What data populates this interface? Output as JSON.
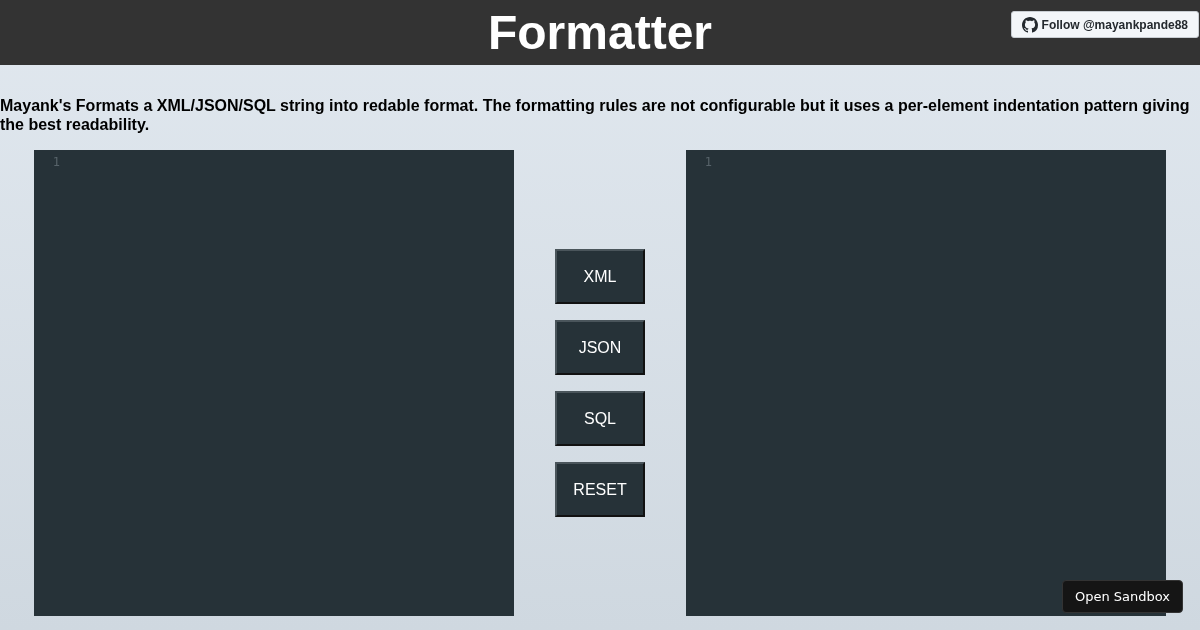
{
  "header": {
    "title": "Formatter",
    "follow_button": {
      "label": "Follow @mayankpande88"
    }
  },
  "description": "Mayank's Formats a XML/JSON/SQL string into redable format. The formatting rules are not configurable but it uses a per-element indentation pattern giving the best readability.",
  "editors": [
    {
      "line_numbers": [
        "1"
      ]
    },
    {
      "line_numbers": [
        "1"
      ]
    }
  ],
  "buttons": [
    "XML",
    "JSON",
    "SQL",
    "RESET"
  ],
  "sandbox_button": {
    "label": "Open Sandbox"
  }
}
